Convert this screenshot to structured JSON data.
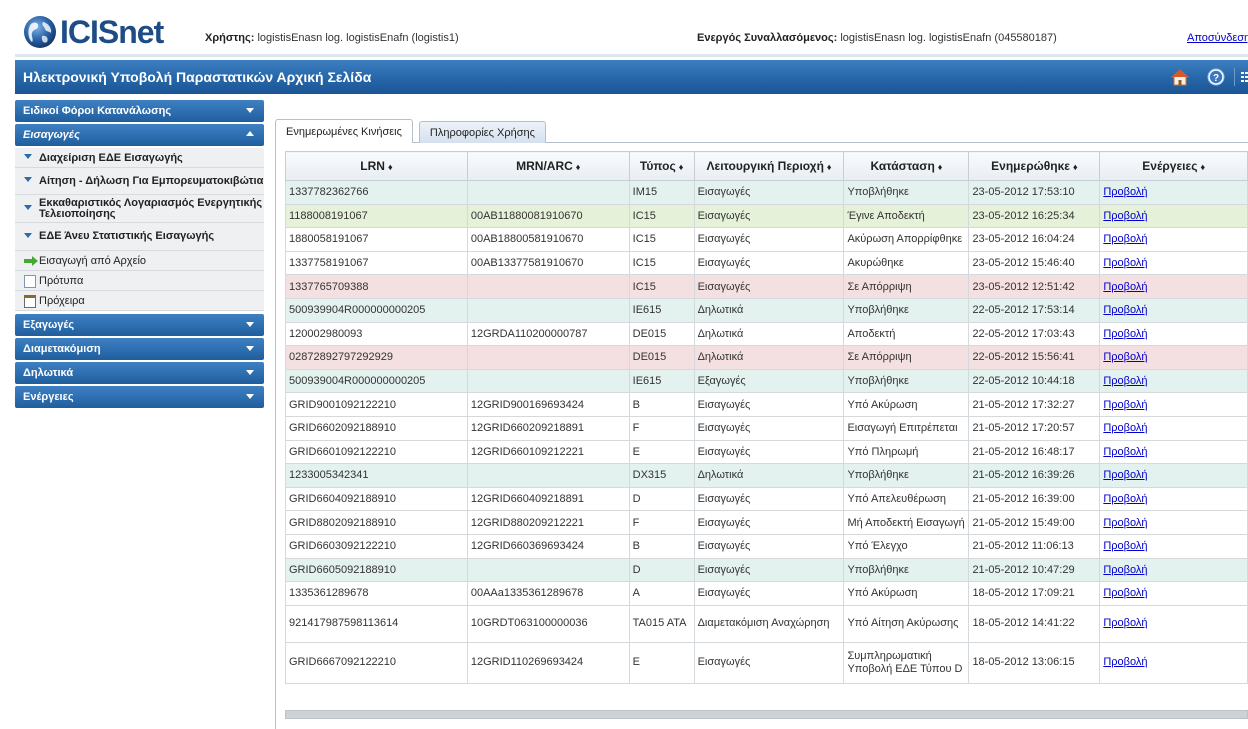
{
  "header": {
    "logo_text": "ICISnet",
    "user_label": "Χρήστης:",
    "user_value": "logistisEnasn log. logistisEnafn (logistis1)",
    "trader_label": "Ενεργός Συναλλασόμενος:",
    "trader_value": "logistisEnasn log. logistisEnafn (045580187)",
    "logout": "Αποσύνδεση"
  },
  "titlebar": {
    "title": "Ηλεκτρονική Υποβολή Παραστατικών Αρχική Σελίδα",
    "icons": [
      "home-icon",
      "help-icon",
      "list-icon",
      "flag-icon"
    ]
  },
  "sidebar": {
    "sections": [
      {
        "label": "Ειδικοί Φόροι Κατανάλωσης",
        "open": false
      },
      {
        "label": "Εισαγωγές",
        "open": true,
        "items": [
          {
            "label": "Διαχείριση ΕΔΕ Εισαγωγής",
            "icon": "triangle-bullet-icon",
            "bold": true
          },
          {
            "label": "Αίτηση - Δήλωση Για Εμπορευματοκιβώτια",
            "icon": "triangle-bullet-icon",
            "bold": true
          },
          {
            "label": "Εκκαθαριστικός Λογαριασμός Ενεργητικής Τελειοποίησης",
            "icon": "triangle-bullet-icon",
            "bold": true
          },
          {
            "label": "ΕΔΕ Άνευ Στατιστικής Εισαγωγής",
            "icon": "triangle-bullet-icon",
            "bold": true
          },
          {
            "label": "Εισαγωγή από Αρχείο",
            "icon": "green-arrow-icon",
            "bold": false
          },
          {
            "label": "Πρότυπα",
            "icon": "document-icon",
            "bold": false
          },
          {
            "label": "Πρόχειρα",
            "icon": "clipboard-icon",
            "bold": false
          }
        ]
      },
      {
        "label": "Εξαγωγές",
        "open": false
      },
      {
        "label": "Διαμετακόμιση",
        "open": false
      },
      {
        "label": "Δηλωτικά",
        "open": false
      },
      {
        "label": "Ενέργειες",
        "open": false
      }
    ]
  },
  "tabs": [
    {
      "label": "Ενημερωμένες Κινήσεις",
      "active": true
    },
    {
      "label": "Πληροφορίες Χρήσης",
      "active": false
    }
  ],
  "table": {
    "sort_glyph": "♦",
    "columns": [
      "LRN",
      "MRN/ARC",
      "Τύπος",
      "Λειτουργική Περιοχή",
      "Κατάσταση",
      "Ενημερώθηκε",
      "Ενέργειες"
    ],
    "colors": {
      "white": "#ffffff",
      "teal": "#e3f1ef",
      "green": "#e6f1d9",
      "pink": "#f4e0e0"
    },
    "rows": [
      {
        "bg": "teal",
        "cells": [
          "1337782362766",
          "",
          "IM15",
          "Εισαγωγές",
          "Υποβλήθηκε",
          "23-05-2012 17:53:10",
          "Προβολή"
        ]
      },
      {
        "bg": "green",
        "cells": [
          "1188008191067",
          "00AB11880081910670",
          "IC15",
          "Εισαγωγές",
          "Έγινε Αποδεκτή",
          "23-05-2012 16:25:34",
          "Προβολή"
        ]
      },
      {
        "bg": "white",
        "cells": [
          "1880058191067",
          "00AB18800581910670",
          "IC15",
          "Εισαγωγές",
          "Ακύρωση Απορρίφθηκε",
          "23-05-2012 16:04:24",
          "Προβολή"
        ]
      },
      {
        "bg": "white",
        "cells": [
          "1337758191067",
          "00AB13377581910670",
          "IC15",
          "Εισαγωγές",
          "Ακυρώθηκε",
          "23-05-2012 15:46:40",
          "Προβολή"
        ]
      },
      {
        "bg": "pink",
        "cells": [
          "1337765709388",
          "",
          "IC15",
          "Εισαγωγές",
          "Σε Απόρριψη",
          "23-05-2012 12:51:42",
          "Προβολή"
        ]
      },
      {
        "bg": "teal",
        "cells": [
          "500939904R000000000205",
          "",
          "IE615",
          "Δηλωτικά",
          "Υποβλήθηκε",
          "22-05-2012 17:53:14",
          "Προβολή"
        ]
      },
      {
        "bg": "white",
        "cells": [
          "120002980093",
          "12GRDA110200000787",
          "DE015",
          "Δηλωτικά",
          "Αποδεκτή",
          "22-05-2012 17:03:43",
          "Προβολή"
        ]
      },
      {
        "bg": "pink",
        "cells": [
          "02872892797292929",
          "",
          "DE015",
          "Δηλωτικά",
          "Σε Απόρριψη",
          "22-05-2012 15:56:41",
          "Προβολή"
        ]
      },
      {
        "bg": "teal",
        "cells": [
          "500939004R000000000205",
          "",
          "IE615",
          "Εξαγωγές",
          "Υποβλήθηκε",
          "22-05-2012 10:44:18",
          "Προβολή"
        ]
      },
      {
        "bg": "white",
        "cells": [
          "GRID9001092122210",
          "12GRID900169693424",
          "B",
          "Εισαγωγές",
          "Υπό Ακύρωση",
          "21-05-2012 17:32:27",
          "Προβολή"
        ]
      },
      {
        "bg": "white",
        "cells": [
          "GRID6602092188910",
          "12GRID660209218891",
          "F",
          "Εισαγωγές",
          "Εισαγωγή Επιτρέπεται",
          "21-05-2012 17:20:57",
          "Προβολή"
        ]
      },
      {
        "bg": "white",
        "cells": [
          "GRID6601092122210",
          "12GRID660109212221",
          "E",
          "Εισαγωγές",
          "Υπό Πληρωμή",
          "21-05-2012 16:48:17",
          "Προβολή"
        ]
      },
      {
        "bg": "teal",
        "cells": [
          "1233005342341",
          "",
          "DX315",
          "Δηλωτικά",
          "Υποβλήθηκε",
          "21-05-2012 16:39:26",
          "Προβολή"
        ]
      },
      {
        "bg": "white",
        "cells": [
          "GRID6604092188910",
          "12GRID660409218891",
          "D",
          "Εισαγωγές",
          "Υπό Απελευθέρωση",
          "21-05-2012 16:39:00",
          "Προβολή"
        ]
      },
      {
        "bg": "white",
        "cells": [
          "GRID8802092188910",
          "12GRID880209212221",
          "F",
          "Εισαγωγές",
          "Μή Αποδεκτή Εισαγωγή",
          "21-05-2012 15:49:00",
          "Προβολή"
        ]
      },
      {
        "bg": "white",
        "cells": [
          "GRID6603092122210",
          "12GRID660369693424",
          "B",
          "Εισαγωγές",
          "Υπό Έλεγχο",
          "21-05-2012 11:06:13",
          "Προβολή"
        ]
      },
      {
        "bg": "teal",
        "cells": [
          "GRID6605092188910",
          "",
          "D",
          "Εισαγωγές",
          "Υποβλήθηκε",
          "21-05-2012 10:47:29",
          "Προβολή"
        ]
      },
      {
        "bg": "white",
        "cells": [
          "1335361289678",
          "00AAa1335361289678",
          "A",
          "Εισαγωγές",
          "Υπό Ακύρωση",
          "18-05-2012 17:09:21",
          "Προβολή"
        ]
      },
      {
        "bg": "white",
        "tall": "tall",
        "cells": [
          "921417987598113614",
          "10GRDT063100000036",
          "TA015 ATA",
          "Διαμετακόμιση Αναχώρηση",
          "Υπό Αίτηση Ακύρωσης",
          "18-05-2012 14:41:22",
          "Προβολή"
        ]
      },
      {
        "bg": "white",
        "tall": "vtall",
        "cells": [
          "GRID6667092122210",
          "12GRID110269693424",
          "E",
          "Εισαγωγές",
          "Συμπληρωματική Υποβολή ΕΔΕ Τύπου D",
          "18-05-2012 13:06:15",
          "Προβολή"
        ]
      }
    ]
  }
}
